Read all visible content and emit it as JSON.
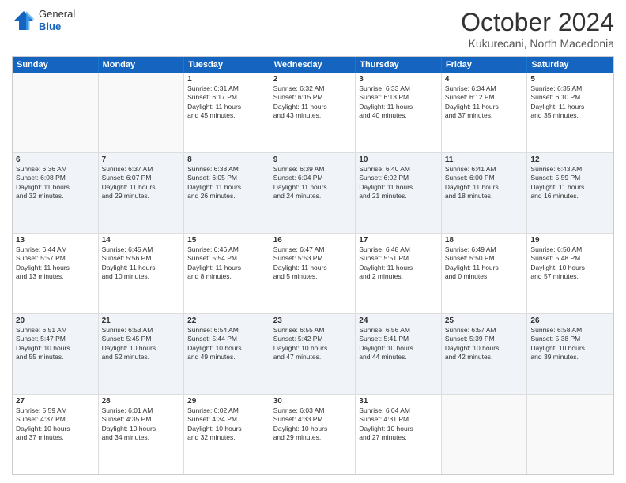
{
  "header": {
    "logo_general": "General",
    "logo_blue": "Blue",
    "month_title": "October 2024",
    "subtitle": "Kukurecani, North Macedonia"
  },
  "days_of_week": [
    "Sunday",
    "Monday",
    "Tuesday",
    "Wednesday",
    "Thursday",
    "Friday",
    "Saturday"
  ],
  "rows": [
    {
      "alt": false,
      "cells": [
        {
          "day": "",
          "lines": []
        },
        {
          "day": "",
          "lines": []
        },
        {
          "day": "1",
          "lines": [
            "Sunrise: 6:31 AM",
            "Sunset: 6:17 PM",
            "Daylight: 11 hours",
            "and 45 minutes."
          ]
        },
        {
          "day": "2",
          "lines": [
            "Sunrise: 6:32 AM",
            "Sunset: 6:15 PM",
            "Daylight: 11 hours",
            "and 43 minutes."
          ]
        },
        {
          "day": "3",
          "lines": [
            "Sunrise: 6:33 AM",
            "Sunset: 6:13 PM",
            "Daylight: 11 hours",
            "and 40 minutes."
          ]
        },
        {
          "day": "4",
          "lines": [
            "Sunrise: 6:34 AM",
            "Sunset: 6:12 PM",
            "Daylight: 11 hours",
            "and 37 minutes."
          ]
        },
        {
          "day": "5",
          "lines": [
            "Sunrise: 6:35 AM",
            "Sunset: 6:10 PM",
            "Daylight: 11 hours",
            "and 35 minutes."
          ]
        }
      ]
    },
    {
      "alt": true,
      "cells": [
        {
          "day": "6",
          "lines": [
            "Sunrise: 6:36 AM",
            "Sunset: 6:08 PM",
            "Daylight: 11 hours",
            "and 32 minutes."
          ]
        },
        {
          "day": "7",
          "lines": [
            "Sunrise: 6:37 AM",
            "Sunset: 6:07 PM",
            "Daylight: 11 hours",
            "and 29 minutes."
          ]
        },
        {
          "day": "8",
          "lines": [
            "Sunrise: 6:38 AM",
            "Sunset: 6:05 PM",
            "Daylight: 11 hours",
            "and 26 minutes."
          ]
        },
        {
          "day": "9",
          "lines": [
            "Sunrise: 6:39 AM",
            "Sunset: 6:04 PM",
            "Daylight: 11 hours",
            "and 24 minutes."
          ]
        },
        {
          "day": "10",
          "lines": [
            "Sunrise: 6:40 AM",
            "Sunset: 6:02 PM",
            "Daylight: 11 hours",
            "and 21 minutes."
          ]
        },
        {
          "day": "11",
          "lines": [
            "Sunrise: 6:41 AM",
            "Sunset: 6:00 PM",
            "Daylight: 11 hours",
            "and 18 minutes."
          ]
        },
        {
          "day": "12",
          "lines": [
            "Sunrise: 6:43 AM",
            "Sunset: 5:59 PM",
            "Daylight: 11 hours",
            "and 16 minutes."
          ]
        }
      ]
    },
    {
      "alt": false,
      "cells": [
        {
          "day": "13",
          "lines": [
            "Sunrise: 6:44 AM",
            "Sunset: 5:57 PM",
            "Daylight: 11 hours",
            "and 13 minutes."
          ]
        },
        {
          "day": "14",
          "lines": [
            "Sunrise: 6:45 AM",
            "Sunset: 5:56 PM",
            "Daylight: 11 hours",
            "and 10 minutes."
          ]
        },
        {
          "day": "15",
          "lines": [
            "Sunrise: 6:46 AM",
            "Sunset: 5:54 PM",
            "Daylight: 11 hours",
            "and 8 minutes."
          ]
        },
        {
          "day": "16",
          "lines": [
            "Sunrise: 6:47 AM",
            "Sunset: 5:53 PM",
            "Daylight: 11 hours",
            "and 5 minutes."
          ]
        },
        {
          "day": "17",
          "lines": [
            "Sunrise: 6:48 AM",
            "Sunset: 5:51 PM",
            "Daylight: 11 hours",
            "and 2 minutes."
          ]
        },
        {
          "day": "18",
          "lines": [
            "Sunrise: 6:49 AM",
            "Sunset: 5:50 PM",
            "Daylight: 11 hours",
            "and 0 minutes."
          ]
        },
        {
          "day": "19",
          "lines": [
            "Sunrise: 6:50 AM",
            "Sunset: 5:48 PM",
            "Daylight: 10 hours",
            "and 57 minutes."
          ]
        }
      ]
    },
    {
      "alt": true,
      "cells": [
        {
          "day": "20",
          "lines": [
            "Sunrise: 6:51 AM",
            "Sunset: 5:47 PM",
            "Daylight: 10 hours",
            "and 55 minutes."
          ]
        },
        {
          "day": "21",
          "lines": [
            "Sunrise: 6:53 AM",
            "Sunset: 5:45 PM",
            "Daylight: 10 hours",
            "and 52 minutes."
          ]
        },
        {
          "day": "22",
          "lines": [
            "Sunrise: 6:54 AM",
            "Sunset: 5:44 PM",
            "Daylight: 10 hours",
            "and 49 minutes."
          ]
        },
        {
          "day": "23",
          "lines": [
            "Sunrise: 6:55 AM",
            "Sunset: 5:42 PM",
            "Daylight: 10 hours",
            "and 47 minutes."
          ]
        },
        {
          "day": "24",
          "lines": [
            "Sunrise: 6:56 AM",
            "Sunset: 5:41 PM",
            "Daylight: 10 hours",
            "and 44 minutes."
          ]
        },
        {
          "day": "25",
          "lines": [
            "Sunrise: 6:57 AM",
            "Sunset: 5:39 PM",
            "Daylight: 10 hours",
            "and 42 minutes."
          ]
        },
        {
          "day": "26",
          "lines": [
            "Sunrise: 6:58 AM",
            "Sunset: 5:38 PM",
            "Daylight: 10 hours",
            "and 39 minutes."
          ]
        }
      ]
    },
    {
      "alt": false,
      "cells": [
        {
          "day": "27",
          "lines": [
            "Sunrise: 5:59 AM",
            "Sunset: 4:37 PM",
            "Daylight: 10 hours",
            "and 37 minutes."
          ]
        },
        {
          "day": "28",
          "lines": [
            "Sunrise: 6:01 AM",
            "Sunset: 4:35 PM",
            "Daylight: 10 hours",
            "and 34 minutes."
          ]
        },
        {
          "day": "29",
          "lines": [
            "Sunrise: 6:02 AM",
            "Sunset: 4:34 PM",
            "Daylight: 10 hours",
            "and 32 minutes."
          ]
        },
        {
          "day": "30",
          "lines": [
            "Sunrise: 6:03 AM",
            "Sunset: 4:33 PM",
            "Daylight: 10 hours",
            "and 29 minutes."
          ]
        },
        {
          "day": "31",
          "lines": [
            "Sunrise: 6:04 AM",
            "Sunset: 4:31 PM",
            "Daylight: 10 hours",
            "and 27 minutes."
          ]
        },
        {
          "day": "",
          "lines": []
        },
        {
          "day": "",
          "lines": []
        }
      ]
    }
  ]
}
